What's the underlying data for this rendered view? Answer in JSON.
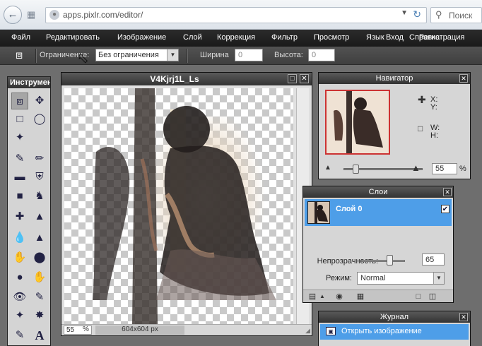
{
  "browser": {
    "url": "apps.pixlr.com/editor/",
    "search_placeholder": "Поиск"
  },
  "menubar": {
    "items": [
      "Файл",
      "Редактировать",
      "Изображение",
      "Слой",
      "Коррекция",
      "Фильтр",
      "Просмотр",
      "Язык",
      "Справка"
    ],
    "login": "Вход",
    "register": "Регистрация"
  },
  "optionbar": {
    "constraint_label": "Ограничение:",
    "constraint_value": "Без ограничения",
    "width_label": "Ширина",
    "width_value": "0",
    "height_label": "Высота:",
    "height_value": "0"
  },
  "toolbox": {
    "title": "Инструменты"
  },
  "canvas": {
    "title": "V4Kjrj1L_Ls",
    "zoom": "55",
    "zoom_unit": "%",
    "dimensions": "604x604 px"
  },
  "navigator": {
    "title": "Навигатор",
    "x_label": "X:",
    "y_label": "Y:",
    "w_label": "W:",
    "h_label": "H:",
    "zoom": "55",
    "zoom_unit": "%",
    "zoom_level": 0.15
  },
  "layers": {
    "title": "Слои",
    "layer_name": "Слой 0",
    "opacity_label": "Непрозрачность:",
    "opacity_value": "65",
    "mode_label": "Режим:",
    "mode_value": "Normal"
  },
  "journal": {
    "title": "Журнал",
    "entry": "Открыть изображение"
  }
}
